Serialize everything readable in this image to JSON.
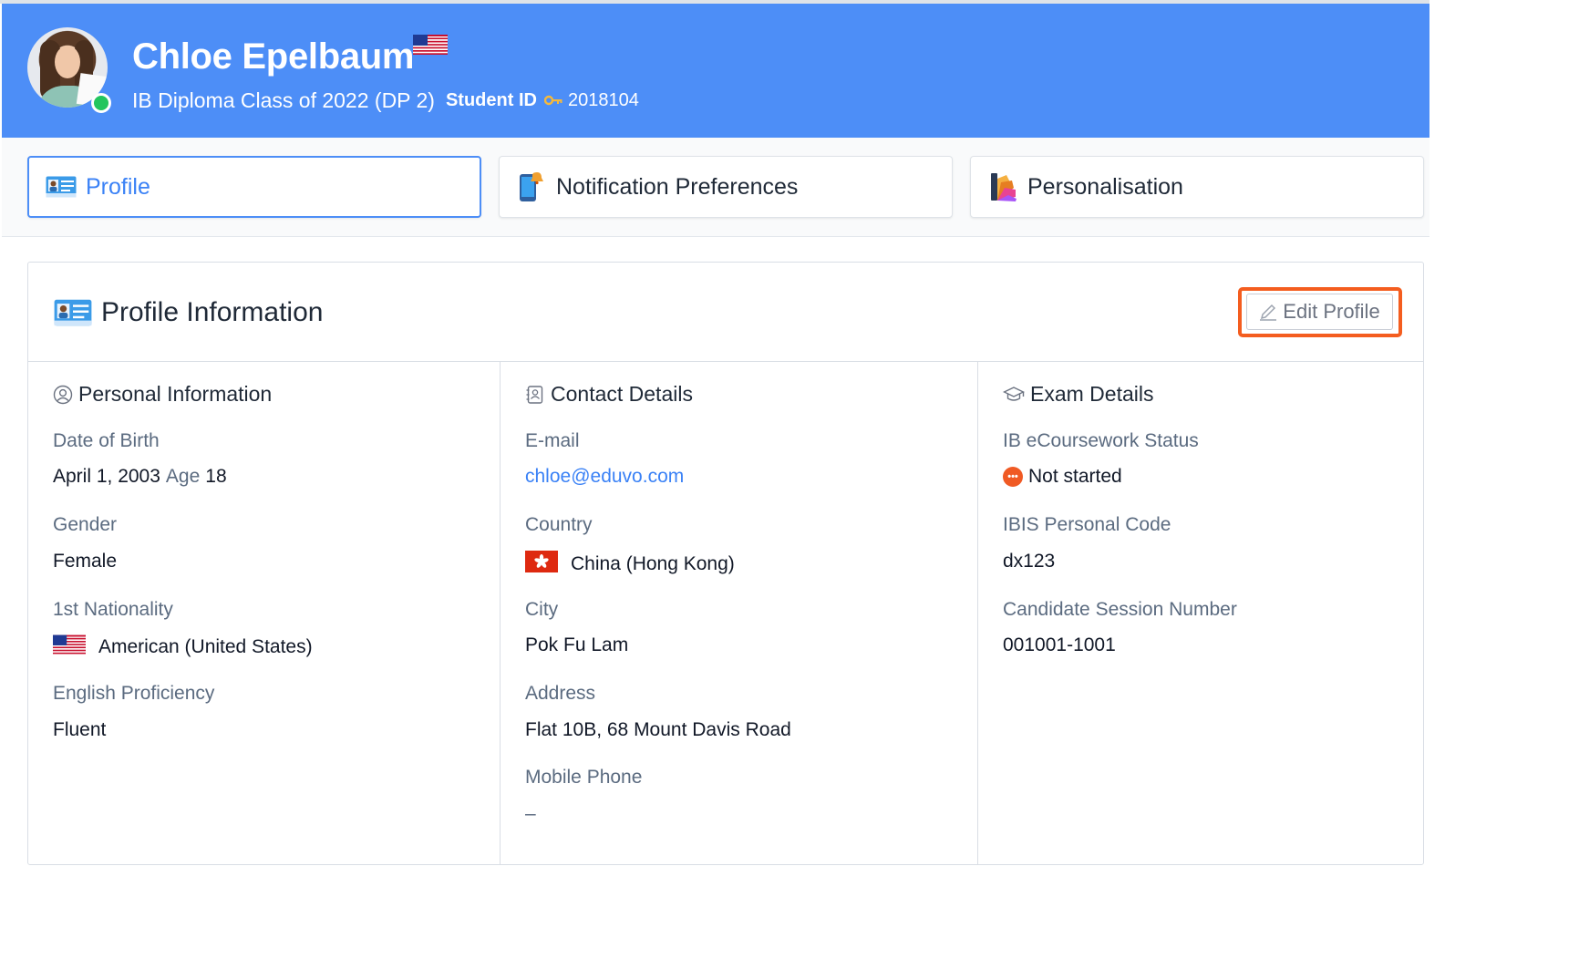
{
  "header": {
    "name": "Chloe Epelbaum",
    "class_line": "IB Diploma Class of 2022 (DP 2)",
    "student_id_label": "Student ID",
    "student_id": "2018104",
    "online_status_color": "#22c55e",
    "background_color": "#4d8ef7"
  },
  "tabs": [
    {
      "label": "Profile",
      "icon": "id-card-icon",
      "active": true
    },
    {
      "label": "Notification Preferences",
      "icon": "phone-bell-icon",
      "active": false
    },
    {
      "label": "Personalisation",
      "icon": "color-palette-icon",
      "active": false
    }
  ],
  "card": {
    "title": "Profile Information",
    "edit_button": "Edit Profile",
    "highlight_color": "#f45d1f"
  },
  "personal": {
    "title": "Personal Information",
    "dob_label": "Date of Birth",
    "dob": "April 1, 2003",
    "age_label": "Age",
    "age": "18",
    "gender_label": "Gender",
    "gender": "Female",
    "nationality_label": "1st Nationality",
    "nationality": "American (United States)",
    "english_label": "English Proficiency",
    "english": "Fluent"
  },
  "contact": {
    "title": "Contact Details",
    "email_label": "E-mail",
    "email": "chloe@eduvo.com",
    "country_label": "Country",
    "country": "China (Hong Kong)",
    "city_label": "City",
    "city": "Pok Fu Lam",
    "address_label": "Address",
    "address": "Flat 10B, 68 Mount Davis Road",
    "mobile_label": "Mobile Phone",
    "mobile": "–"
  },
  "exam": {
    "title": "Exam Details",
    "ecoursework_label": "IB eCoursework Status",
    "ecoursework": "Not started",
    "ecoursework_status_color": "#f05a24",
    "ibis_label": "IBIS Personal Code",
    "ibis": "dx123",
    "session_label": "Candidate Session Number",
    "session": "001001-1001"
  }
}
